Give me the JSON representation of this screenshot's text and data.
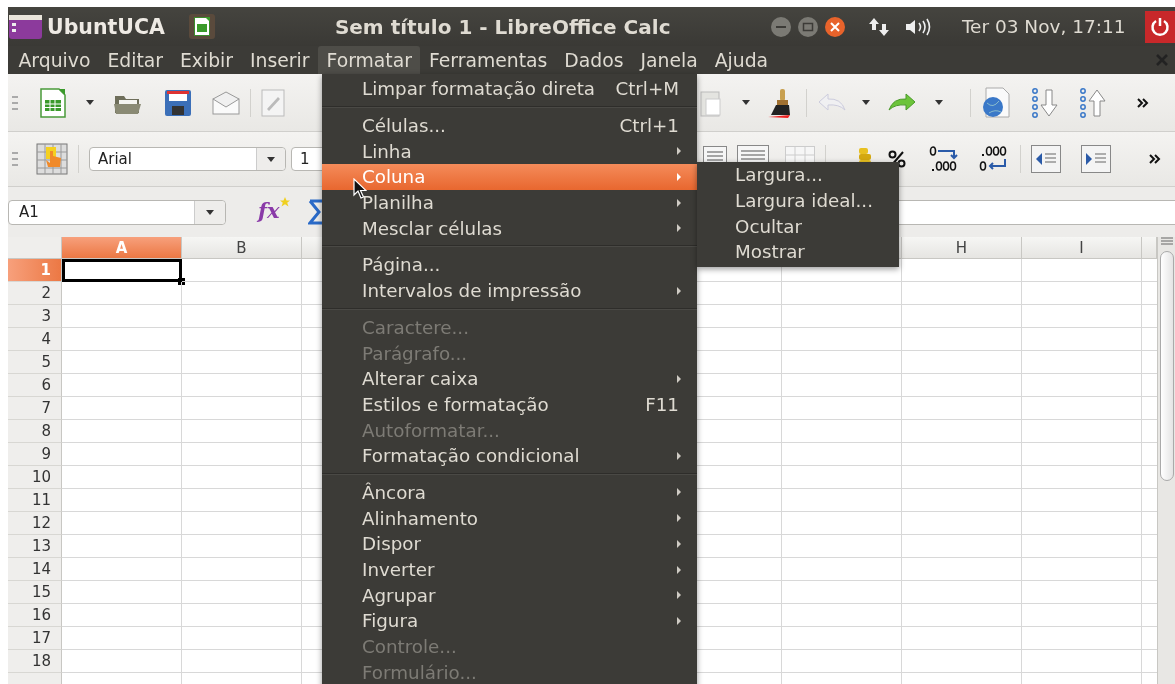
{
  "top_panel": {
    "app_name": "UbuntUCA",
    "window_title": "Sem título 1 - LibreOffice Calc",
    "clock": "Ter 03 Nov, 17:11"
  },
  "menubar": [
    {
      "label": "Arquivo",
      "selected": false
    },
    {
      "label": "Editar",
      "selected": false
    },
    {
      "label": "Exibir",
      "selected": false
    },
    {
      "label": "Inserir",
      "selected": false
    },
    {
      "label": "Formatar",
      "selected": true
    },
    {
      "label": "Ferramentas",
      "selected": false
    },
    {
      "label": "Dados",
      "selected": false
    },
    {
      "label": "Janela",
      "selected": false
    },
    {
      "label": "Ajuda",
      "selected": false
    }
  ],
  "formatting_bar": {
    "font_name": "Arial",
    "font_size": "1"
  },
  "formula_bar": {
    "name_box": "A1",
    "function_wizard_label": "fx"
  },
  "sheet": {
    "columns_left": [
      {
        "label": "A",
        "selected": true
      },
      {
        "label": "B",
        "selected": false
      }
    ],
    "columns_right": [
      {
        "label": "H",
        "selected": false
      },
      {
        "label": "I",
        "selected": false
      }
    ],
    "rows": [
      {
        "label": "1",
        "selected": true
      },
      {
        "label": "2",
        "selected": false
      },
      {
        "label": "3",
        "selected": false
      },
      {
        "label": "4",
        "selected": false
      },
      {
        "label": "5",
        "selected": false
      },
      {
        "label": "6",
        "selected": false
      },
      {
        "label": "7",
        "selected": false
      },
      {
        "label": "8",
        "selected": false
      },
      {
        "label": "9",
        "selected": false
      },
      {
        "label": "10",
        "selected": false
      },
      {
        "label": "11",
        "selected": false
      },
      {
        "label": "12",
        "selected": false
      },
      {
        "label": "13",
        "selected": false
      },
      {
        "label": "14",
        "selected": false
      },
      {
        "label": "15",
        "selected": false
      },
      {
        "label": "16",
        "selected": false
      },
      {
        "label": "17",
        "selected": false
      },
      {
        "label": "18",
        "selected": false
      }
    ]
  },
  "format_menu": {
    "items": [
      {
        "kind": "item",
        "label": "Limpar formatação direta",
        "shortcut": "Ctrl+M",
        "submenu": false,
        "disabled": false,
        "selected": false
      },
      {
        "kind": "separator"
      },
      {
        "kind": "item",
        "label": "Células...",
        "shortcut": "Ctrl+1",
        "submenu": false,
        "disabled": false,
        "selected": false
      },
      {
        "kind": "item",
        "label": "Linha",
        "submenu": true,
        "disabled": false,
        "selected": false
      },
      {
        "kind": "item",
        "label": "Coluna",
        "submenu": true,
        "disabled": false,
        "selected": true
      },
      {
        "kind": "item",
        "label": "Planilha",
        "submenu": true,
        "disabled": false,
        "selected": false
      },
      {
        "kind": "item",
        "label": "Mesclar células",
        "submenu": true,
        "disabled": false,
        "selected": false
      },
      {
        "kind": "separator"
      },
      {
        "kind": "item",
        "label": "Página...",
        "submenu": false,
        "disabled": false,
        "selected": false
      },
      {
        "kind": "item",
        "label": "Intervalos de impressão",
        "submenu": true,
        "disabled": false,
        "selected": false
      },
      {
        "kind": "separator"
      },
      {
        "kind": "item",
        "label": "Caractere...",
        "submenu": false,
        "disabled": true,
        "selected": false
      },
      {
        "kind": "item",
        "label": "Parágrafo...",
        "submenu": false,
        "disabled": true,
        "selected": false
      },
      {
        "kind": "item",
        "label": "Alterar caixa",
        "submenu": true,
        "disabled": false,
        "selected": false
      },
      {
        "kind": "item",
        "label": "Estilos e formatação",
        "shortcut": "F11",
        "submenu": false,
        "disabled": false,
        "selected": false
      },
      {
        "kind": "item",
        "label": "Autoformatar...",
        "submenu": false,
        "disabled": true,
        "selected": false
      },
      {
        "kind": "item",
        "label": "Formatação condicional",
        "submenu": true,
        "disabled": false,
        "selected": false
      },
      {
        "kind": "separator"
      },
      {
        "kind": "item",
        "label": "Âncora",
        "submenu": true,
        "disabled": false,
        "selected": false
      },
      {
        "kind": "item",
        "label": "Alinhamento",
        "submenu": true,
        "disabled": false,
        "selected": false
      },
      {
        "kind": "item",
        "label": "Dispor",
        "submenu": true,
        "disabled": false,
        "selected": false
      },
      {
        "kind": "item",
        "label": "Inverter",
        "submenu": true,
        "disabled": false,
        "selected": false
      },
      {
        "kind": "item",
        "label": "Agrupar",
        "submenu": true,
        "disabled": false,
        "selected": false
      },
      {
        "kind": "item",
        "label": "Figura",
        "submenu": true,
        "disabled": false,
        "selected": false
      },
      {
        "kind": "item",
        "label": "Controle...",
        "submenu": false,
        "disabled": true,
        "selected": false
      },
      {
        "kind": "item",
        "label": "Formulário...",
        "submenu": false,
        "disabled": true,
        "selected": false
      }
    ]
  },
  "column_submenu": {
    "items": [
      {
        "label": "Largura..."
      },
      {
        "label": "Largura ideal..."
      },
      {
        "label": "Ocultar"
      },
      {
        "label": "Mostrar"
      }
    ]
  }
}
